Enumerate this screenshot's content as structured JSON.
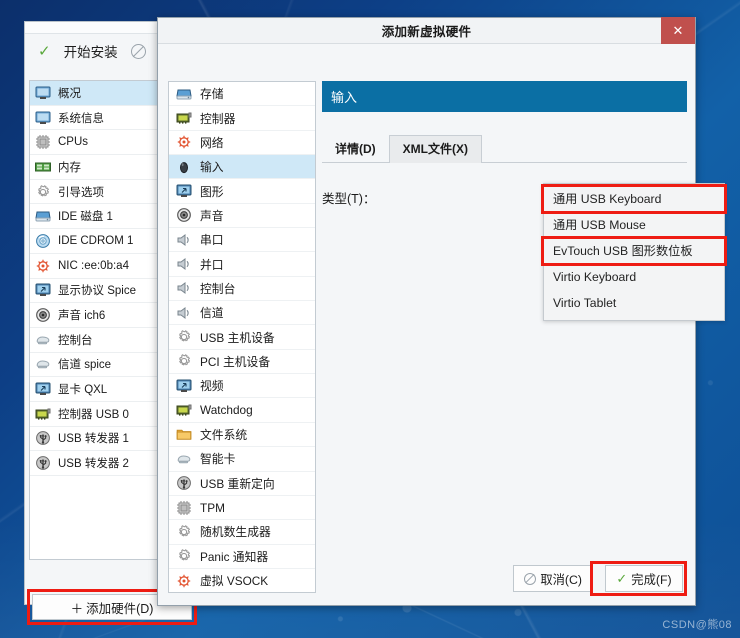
{
  "background": {
    "accent": "#0d3f86",
    "watermark": "CSDN@熊08"
  },
  "back_window": {
    "begin_install_label": "开始安装",
    "check_icon": "✓",
    "cancel_icon": "ban-icon",
    "add_hardware_button": "添加硬件(D)",
    "add_hardware_plus": "＋",
    "items": [
      {
        "label": "概况",
        "icon": "monitor-icon",
        "selected": true
      },
      {
        "label": "系统信息",
        "icon": "monitor-icon",
        "selected": false
      },
      {
        "label": "CPUs",
        "icon": "cpu-chip-icon",
        "selected": false
      },
      {
        "label": "内存",
        "icon": "memory-icon",
        "selected": false
      },
      {
        "label": "引导选项",
        "icon": "gear-icon",
        "selected": false
      },
      {
        "label": "IDE 磁盘 1",
        "icon": "harddisk-icon",
        "selected": false
      },
      {
        "label": "IDE CDROM 1",
        "icon": "cdrom-icon",
        "selected": false
      },
      {
        "label": "NIC :ee:0b:a4",
        "icon": "network-icon",
        "selected": false
      },
      {
        "label": "显示协议 Spice",
        "icon": "display-icon",
        "selected": false
      },
      {
        "label": "声音 ich6",
        "icon": "sound-icon",
        "selected": false
      },
      {
        "label": "控制台",
        "icon": "console-icon",
        "selected": false
      },
      {
        "label": "信道 spice",
        "icon": "console-icon",
        "selected": false
      },
      {
        "label": "显卡 QXL",
        "icon": "display-icon",
        "selected": false
      },
      {
        "label": "控制器 USB 0",
        "icon": "controller-card-icon",
        "selected": false
      },
      {
        "label": "USB 转发器 1",
        "icon": "usb-icon",
        "selected": false
      },
      {
        "label": "USB 转发器 2",
        "icon": "usb-icon",
        "selected": false
      }
    ]
  },
  "dialog": {
    "title": "添加新虚拟硬件",
    "close_label": "✕",
    "hardware_items": [
      {
        "label": "存储",
        "icon": "storage-icon",
        "selected": false
      },
      {
        "label": "控制器",
        "icon": "controller-card-icon",
        "selected": false
      },
      {
        "label": "网络",
        "icon": "network-icon",
        "selected": false
      },
      {
        "label": "输入",
        "icon": "input-mouse-icon",
        "selected": true
      },
      {
        "label": "图形",
        "icon": "display-icon",
        "selected": false
      },
      {
        "label": "声音",
        "icon": "sound-icon",
        "selected": false
      },
      {
        "label": "串口",
        "icon": "serial-port-icon",
        "selected": false
      },
      {
        "label": "并口",
        "icon": "serial-port-icon",
        "selected": false
      },
      {
        "label": "控制台",
        "icon": "serial-port-icon",
        "selected": false
      },
      {
        "label": "信道",
        "icon": "serial-port-icon",
        "selected": false
      },
      {
        "label": "USB 主机设备",
        "icon": "gear-icon",
        "selected": false
      },
      {
        "label": "PCI 主机设备",
        "icon": "gear-icon",
        "selected": false
      },
      {
        "label": "视频",
        "icon": "display-icon",
        "selected": false
      },
      {
        "label": "Watchdog",
        "icon": "controller-card-icon",
        "selected": false
      },
      {
        "label": "文件系统",
        "icon": "folder-icon",
        "selected": false
      },
      {
        "label": "智能卡",
        "icon": "console-icon",
        "selected": false
      },
      {
        "label": "USB 重新定向",
        "icon": "usb-icon",
        "selected": false
      },
      {
        "label": "TPM",
        "icon": "cpu-chip-icon",
        "selected": false
      },
      {
        "label": "随机数生成器",
        "icon": "gear-icon",
        "selected": false
      },
      {
        "label": "Panic 通知器",
        "icon": "gear-icon",
        "selected": false
      },
      {
        "label": "虚拟 VSOCK",
        "icon": "network-icon",
        "selected": false
      }
    ],
    "panel_header": "输入",
    "tabs": [
      {
        "label": "详情(D)",
        "active": false
      },
      {
        "label": "XML文件(X)",
        "active": true
      }
    ],
    "type_label": "类型(T)：",
    "type_options": [
      {
        "label": "通用 USB Keyboard",
        "highlighted": true
      },
      {
        "label": "通用 USB Mouse",
        "highlighted": false
      },
      {
        "label": "EvTouch USB 图形数位板",
        "highlighted": true
      },
      {
        "label": "Virtio Keyboard",
        "highlighted": false
      },
      {
        "label": "Virtio Tablet",
        "highlighted": false
      }
    ],
    "cancel_button": "取消(C)",
    "finish_button": "完成(F)",
    "finish_check": "✓"
  }
}
